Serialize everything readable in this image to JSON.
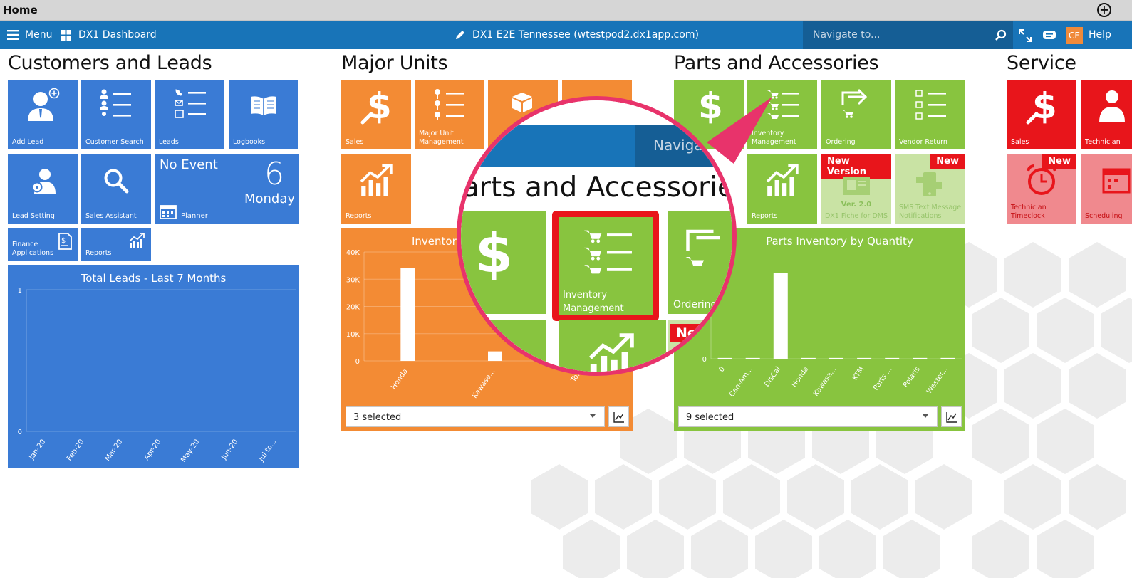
{
  "window": {
    "title": "Home"
  },
  "navbar": {
    "menu_label": "Menu",
    "dashboard_label": "DX1 Dashboard",
    "store_label": "DX1 E2E Tennessee (wtestpod2.dx1app.com)",
    "search_placeholder": "Navigate to...",
    "user_initials": "CE",
    "help_label": "Help"
  },
  "colors": {
    "nav_blue": "#1874b8",
    "tile_blue": "#3a7bd5",
    "tile_orange": "#f38b34",
    "tile_green": "#88c43f",
    "tile_red": "#e8151b",
    "highlight_pink": "#e8336b"
  },
  "customers": {
    "title": "Customers and Leads",
    "tiles": {
      "add_lead": "Add Lead",
      "customer_search": "Customer Search",
      "leads": "Leads",
      "logbooks": "Logbooks",
      "lead_setting": "Lead Setting",
      "sales_assistant": "Sales Assistant",
      "finance": "Finance Applications",
      "reports": "Reports"
    },
    "planner": {
      "event": "No Event",
      "day_num": "6",
      "day_name": "Monday",
      "label": "Planner"
    }
  },
  "major_units": {
    "title": "Major Units",
    "tiles": {
      "sales": "Sales",
      "management": "Major Unit Management",
      "reports": "Reports"
    },
    "select_value": "3 selected"
  },
  "parts": {
    "title": "Parts and Accessories",
    "tiles": {
      "sales": "",
      "inventory": "Inventory Management",
      "ordering": "Ordering",
      "vendor_return": "Vendor Return",
      "reports": "Reports",
      "fiche": "DX1 Fiche for DMS",
      "fiche_version": "Ver. 2.0",
      "sms": "SMS Text Message Notifications",
      "badge_new_version": "New Version",
      "badge_new": "New"
    },
    "select_value": "9 selected"
  },
  "service": {
    "title": "Service",
    "tiles": {
      "sales": "Sales",
      "technician": "Technician",
      "timeclock": "Technician Timeclock",
      "scheduling": "Scheduling",
      "badge_new": "New"
    }
  },
  "magnifier": {
    "search_fragment": "Navigat",
    "heading_fragment": "arts and Accessories",
    "inventory_label": "Inventory Management",
    "ordering_label": "Ordering",
    "badge_fragment": "Ne"
  },
  "chart_data": [
    {
      "type": "bar",
      "title": "Total Leads - Last 7 Months",
      "categories": [
        "Jan-20",
        "Feb-20",
        "Mar-20",
        "Apr-20",
        "May-20",
        "Jun-20",
        "Jul to..."
      ],
      "values": [
        0,
        0,
        0,
        0,
        0,
        0,
        0
      ],
      "y_ticks": [
        "1",
        "0"
      ],
      "ylim": [
        0,
        1
      ]
    },
    {
      "type": "bar",
      "title": "Inventory",
      "categories": [
        "Honda",
        "Kawasa...",
        "To..."
      ],
      "values": [
        34000,
        3500,
        0
      ],
      "y_ticks": [
        "40K",
        "30K",
        "20K",
        "10K",
        "0"
      ],
      "ylim": [
        0,
        40000
      ]
    },
    {
      "type": "bar",
      "title": "Parts Inventory by Quantity",
      "categories": [
        "0",
        "Can-Am...",
        "DisCal",
        "Honda",
        "Kawasa...",
        "KTM",
        "Parts ...",
        "Polaris",
        "Wester..."
      ],
      "values": [
        0.3,
        0.3,
        32,
        0.3,
        0.3,
        0.3,
        0.3,
        0.3,
        0.3
      ],
      "y_ticks": [
        "0"
      ],
      "ylim": [
        0,
        40
      ]
    }
  ]
}
